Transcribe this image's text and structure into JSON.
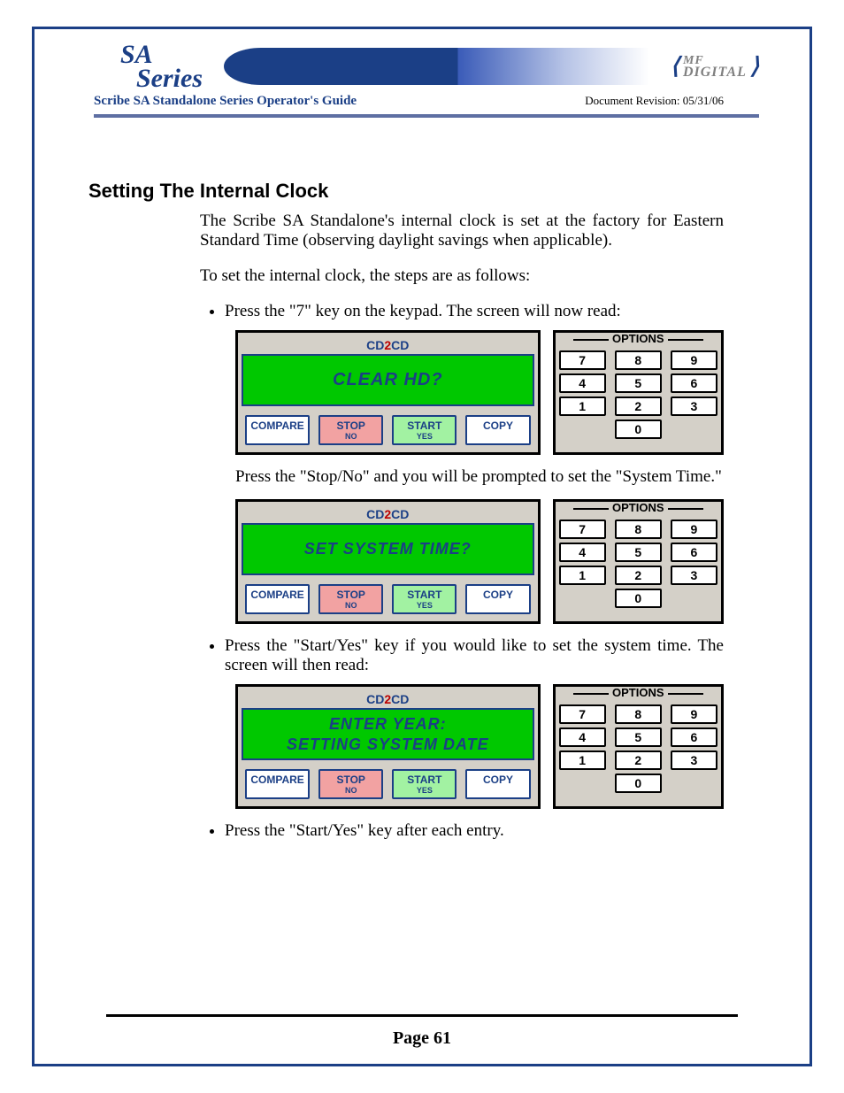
{
  "header": {
    "logo_line1": "SA",
    "logo_line2": "Series",
    "guide_title": "Scribe SA Standalone Series Operator's Guide",
    "revision_label": "Document Revision: 05/31/06",
    "mf_top": "MF",
    "mf_bot": "DIGITAL"
  },
  "section": {
    "title": "Setting The Internal Clock",
    "intro": "The Scribe SA Standalone's internal clock is set at the factory for Eastern Standard Time (observing daylight savings when applicable).",
    "lead": "To set the internal clock, the steps are as follows:",
    "bullet1": "Press the \"7\" key on the keypad. The screen will now read:",
    "after_panel1": "Press the \"Stop/No\" and you will be prompted to set the \"System Time.\"",
    "bullet2": "Press the \"Start/Yes\" key if you would like to set the system time. The screen will then read:",
    "bullet3": "Press the \"Start/Yes\" key after each entry."
  },
  "panel_common": {
    "title_cd": "CD",
    "title_2": "2",
    "btn_compare": "COMPARE",
    "btn_stop": "STOP",
    "btn_stop_sub": "NO",
    "btn_start": "START",
    "btn_start_sub": "YES",
    "btn_copy": "COPY",
    "options_label": "OPTIONS",
    "keys": [
      "7",
      "8",
      "9",
      "4",
      "5",
      "6",
      "1",
      "2",
      "3",
      "0"
    ]
  },
  "panel1": {
    "line1": "CLEAR HD?"
  },
  "panel2": {
    "line1": "SET SYSTEM TIME?"
  },
  "panel3": {
    "line1": "ENTER YEAR:",
    "line2": "SETTING SYSTEM DATE"
  },
  "footer": {
    "page": "Page 61"
  }
}
